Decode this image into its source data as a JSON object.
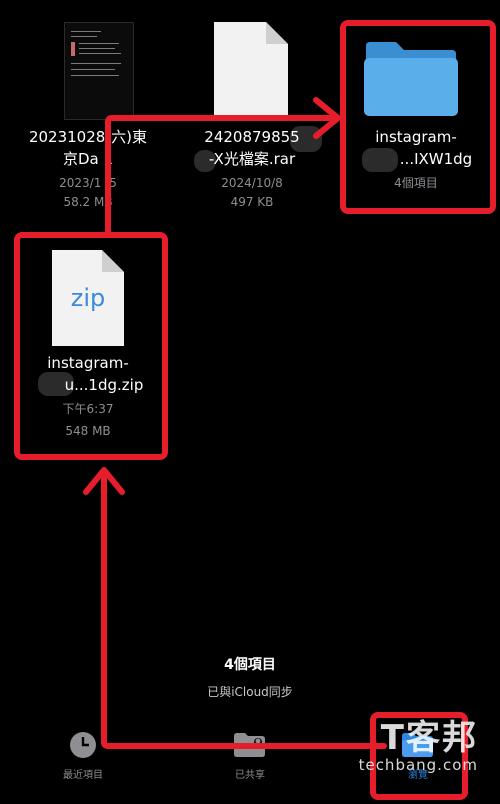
{
  "files": [
    {
      "name_line1": "20231028(六)東",
      "name_line2": "京Da  1",
      "date": "2023/1 /5",
      "size": "58.2 MB",
      "icon": "document-thumbnail-icon"
    },
    {
      "name_line1": "2420879855",
      "name_line2": "-X光檔案.rar",
      "date": "2024/10/8",
      "size": "497 KB",
      "icon": "archive-file-icon"
    },
    {
      "name_line1": "instagram-",
      "name_line2": "...IXW1dg",
      "date": "4個項目",
      "size": "",
      "icon": "folder-icon"
    },
    {
      "name_line1": "instagram-",
      "name_line2": "u...1dg.zip",
      "date": "下午6:37",
      "size": "548 MB",
      "icon": "zip-file-icon",
      "icon_text": "zip"
    }
  ],
  "status": {
    "count": "4個項目",
    "sync": "已與iCloud同步"
  },
  "tabs": [
    {
      "label": "最近項目",
      "icon": "clock-icon"
    },
    {
      "label": "已共享",
      "icon": "shared-folder-icon"
    },
    {
      "label": "瀏覽",
      "icon": "browse-folder-icon",
      "active": true
    }
  ],
  "colors": {
    "annotation": "#e61e2b",
    "folder": "#3f9be0",
    "active_tab": "#2f86de",
    "zip_text": "#3c8ad8"
  },
  "watermark": {
    "brand": "T客邦",
    "site": "techbang.com"
  }
}
